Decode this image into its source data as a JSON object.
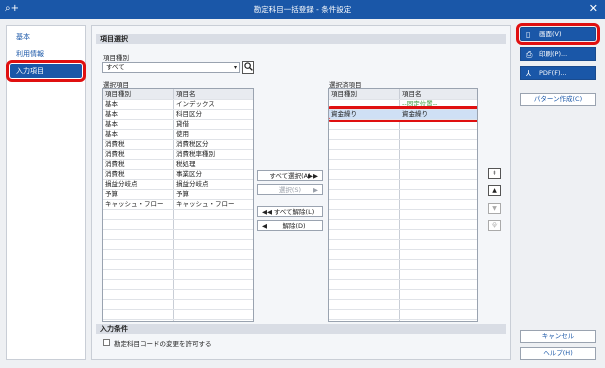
{
  "window": {
    "title": "勘定科目一括登録 - 条件設定",
    "app_icon": "⌕+",
    "close": "✕"
  },
  "sidebar": {
    "items": [
      {
        "label": "基本"
      },
      {
        "label": "利用情報"
      },
      {
        "label": "入力項目"
      }
    ]
  },
  "item_selection": {
    "header": "項目選択",
    "type_label": "項目種別",
    "type_value": "すべて",
    "available_label": "選択項目",
    "selected_label": "選択済項目",
    "columns": [
      "項目種別",
      "項目名"
    ],
    "available": [
      [
        "基本",
        "インデックス"
      ],
      [
        "基本",
        "科目区分"
      ],
      [
        "基本",
        "貸借"
      ],
      [
        "基本",
        "使用"
      ],
      [
        "消費税",
        "消費税区分"
      ],
      [
        "消費税",
        "消費税率種別"
      ],
      [
        "消費税",
        "税処理"
      ],
      [
        "消費税",
        "事業区分"
      ],
      [
        "損益分岐点",
        "損益分岐点"
      ],
      [
        "予算",
        "予算"
      ],
      [
        "キャッシュ・フロー",
        "キャッシュ・フロー"
      ]
    ],
    "fixed_row_label": "--固定位置--",
    "selected": [
      [
        "資金繰り",
        "資金繰り"
      ]
    ]
  },
  "mid_buttons": {
    "select_all": "すべて選択(A)",
    "select": "選択(S)",
    "clear_all": "すべて解除(L)",
    "clear": "解除(D)"
  },
  "order_buttons": {
    "top": "⯒",
    "up": "▲",
    "down": "▼",
    "bottom": "⯓"
  },
  "input_conditions": {
    "header": "入力条件",
    "allow_code_change": "勘定科目コードの変更を許可する"
  },
  "actions": {
    "screen": "画面(V)",
    "print": "印刷(P)...",
    "pdf": "PDF(F)...",
    "pattern": "パターン作成(C)",
    "cancel": "キャンセル",
    "help": "ヘルプ(H)"
  }
}
